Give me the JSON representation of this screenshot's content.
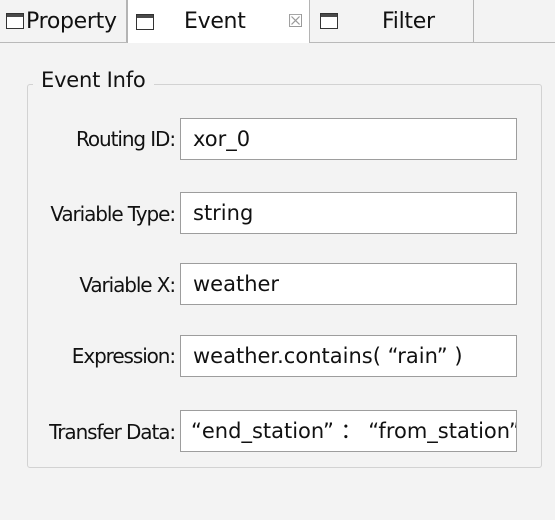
{
  "tabs": [
    {
      "label": "Property",
      "icon": "panel-icon",
      "active": false
    },
    {
      "label": "Event",
      "icon": "panel-icon",
      "active": true,
      "close_icon": "close-icon",
      "close_glyph": "☒"
    },
    {
      "label": "Filter",
      "icon": "panel-icon",
      "active": false
    }
  ],
  "event_info": {
    "title": "Event Info",
    "fields": [
      {
        "label": "Routing ID:",
        "value": "xor_0"
      },
      {
        "label": "Variable Type:",
        "value": "string"
      },
      {
        "label": "Variable X:",
        "value": "weather"
      },
      {
        "label": "Expression:",
        "value": "weather.contains( “rain” )"
      },
      {
        "label": "Transfer Data:",
        "value": "“end_station” ： “from_station”"
      }
    ]
  },
  "colors": {
    "background": "#f3f3f3",
    "active_tab": "#ffffff",
    "field_border": "#9d9d9d",
    "group_border": "#d2d2d2"
  }
}
